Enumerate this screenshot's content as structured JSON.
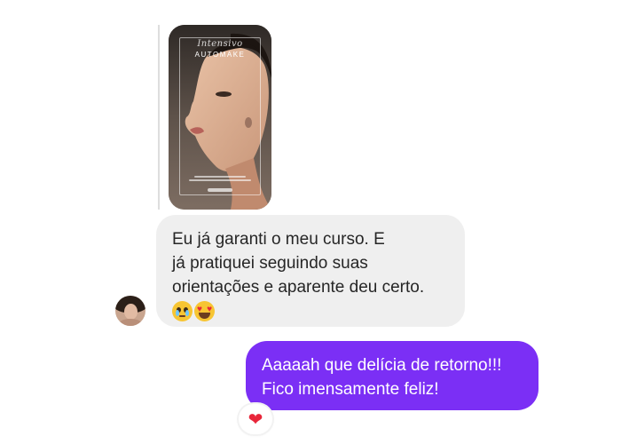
{
  "story": {
    "script_text": "Intensivo",
    "title": "AUTOMAKE"
  },
  "messages": [
    {
      "direction": "received",
      "lines": [
        "Eu já garanti o meu curso. E",
        "já pratiquei seguindo suas",
        "orientações e aparente deu certo."
      ],
      "emojis": [
        "pleading-face-emoji",
        "heart-eyes-emoji"
      ]
    },
    {
      "direction": "sent",
      "lines": [
        "Aaaaah que delícia de retorno!!!",
        "Fico imensamente feliz!"
      ],
      "reaction": "❤"
    }
  ],
  "colors": {
    "sent_bubble": "#7b2ff5",
    "received_bubble": "#efefef",
    "reaction_heart": "#e8263a"
  }
}
